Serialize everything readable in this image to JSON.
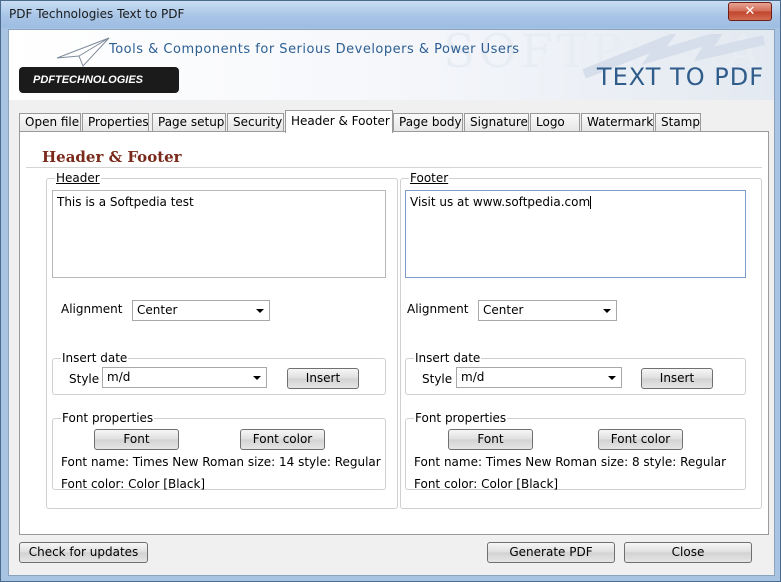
{
  "window": {
    "title": "PDF Technologies Text to PDF",
    "close_glyph": "✕"
  },
  "banner": {
    "tagline": "Tools & Components for Serious Developers & Power Users",
    "product_title": "TEXT TO PDF",
    "logo_text": "PDFTECHNOLOGIES",
    "watermark": "SOFTPEDIA"
  },
  "tabs": [
    "Open file",
    "Properties",
    "Page setup",
    "Security",
    "Header & Footer",
    "Page body",
    "Signature",
    "Logo",
    "Watermark",
    "Stamp"
  ],
  "active_tab": "Header & Footer",
  "panel": {
    "heading": "Header & Footer"
  },
  "header": {
    "group_label": "Header",
    "text": "This is a Softpedia test",
    "alignment_label": "Alignment",
    "alignment_value": "Center",
    "insert_date_label": "Insert date",
    "style_label": "Style",
    "style_value": "m/d",
    "insert_button": "Insert",
    "font_properties_label": "Font properties",
    "font_button": "Font",
    "font_color_button": "Font color",
    "font_name_line": "Font name: Times New Roman size: 14 style: Regular",
    "font_color_line": "Font color: Color [Black]"
  },
  "footer": {
    "group_label": "Footer",
    "text": "Visit us at www.softpedia.com",
    "alignment_label": "Alignment",
    "alignment_value": "Center",
    "insert_date_label": "Insert date",
    "style_label": "Style",
    "style_value": "m/d",
    "insert_button": "Insert",
    "font_properties_label": "Font properties",
    "font_button": "Font",
    "font_color_button": "Font color",
    "font_name_line": "Font name: Times New Roman size: 8 style: Regular",
    "font_color_line": "Font color: Color [Black]"
  },
  "bottom": {
    "check_updates_button": "Check for  updates",
    "generate_pdf_button": "Generate PDF",
    "close_button": "Close"
  },
  "colors": {
    "heading": "#7a2a1a",
    "tagline": "#2d5f93",
    "titlebar": "#a9c4e2"
  }
}
